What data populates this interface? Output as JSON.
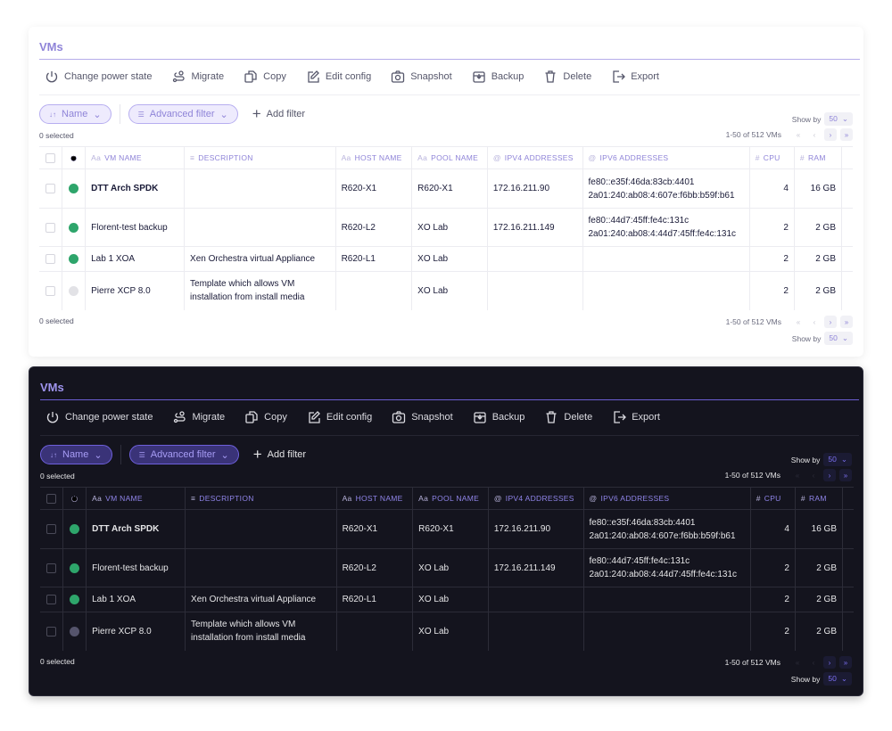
{
  "title": "VMs",
  "toolbar": [
    {
      "label": "Change power state",
      "icon": "power-icon"
    },
    {
      "label": "Migrate",
      "icon": "migrate-icon"
    },
    {
      "label": "Copy",
      "icon": "copy-icon"
    },
    {
      "label": "Edit config",
      "icon": "edit-icon"
    },
    {
      "label": "Snapshot",
      "icon": "camera-icon"
    },
    {
      "label": "Backup",
      "icon": "backup-icon"
    },
    {
      "label": "Delete",
      "icon": "trash-icon"
    },
    {
      "label": "Export",
      "icon": "export-icon"
    }
  ],
  "filters": {
    "sort_label": "Name",
    "advanced_label": "Advanced filter",
    "add_label": "Add filter"
  },
  "selected_text": "0 selected",
  "pagination": {
    "range_text": "1-50 of 512 VMs",
    "show_by_label": "Show by",
    "show_by_value": "50"
  },
  "columns": [
    {
      "label": "VM NAME",
      "icon": "Aa"
    },
    {
      "label": "DESCRIPTION",
      "icon": "≡"
    },
    {
      "label": "HOST NAME",
      "icon": "Aa"
    },
    {
      "label": "POOL NAME",
      "icon": "Aa"
    },
    {
      "label": "IPV4 ADDRESSES",
      "icon": "@"
    },
    {
      "label": "IPV6 ADDRESSES",
      "icon": "@"
    },
    {
      "label": "CPU",
      "icon": "#"
    },
    {
      "label": "RAM",
      "icon": "#"
    }
  ],
  "colors": {
    "running": "#2ea56b",
    "halted_light": "#e2e2e6",
    "halted_dark": "#55546c",
    "accent": "#8f84d8"
  },
  "rows": [
    {
      "status": "running",
      "name": "DTT Arch SPDK",
      "bold": true,
      "description": "",
      "host": "R620-X1",
      "pool": "R620-X1",
      "ipv4": "172.16.211.90",
      "ipv6": [
        "fe80::e35f:46da:83cb:4401",
        "2a01:240:ab08:4:607e:f6bb:b59f:b61"
      ],
      "cpu": "4",
      "ram": "16 GB"
    },
    {
      "status": "running",
      "name": "Florent-test backup",
      "description": "",
      "host": "R620-L2",
      "pool": "XO Lab",
      "ipv4": "172.16.211.149",
      "ipv6": [
        "fe80::44d7:45ff:fe4c:131c",
        "2a01:240:ab08:4:44d7:45ff:fe4c:131c"
      ],
      "cpu": "2",
      "ram": "2 GB"
    },
    {
      "status": "running",
      "name": "Lab 1 XOA",
      "description": "Xen Orchestra virtual Appliance",
      "host": "R620-L1",
      "pool": "XO Lab",
      "ipv4": "",
      "ipv6": [],
      "cpu": "2",
      "ram": "2 GB"
    },
    {
      "status": "halted",
      "name": "Pierre XCP 8.0",
      "description": "Template which allows VM\ninstallation from install media",
      "host": "",
      "pool": "XO Lab",
      "ipv4": "",
      "ipv6": [],
      "cpu": "2",
      "ram": "2 GB"
    }
  ]
}
